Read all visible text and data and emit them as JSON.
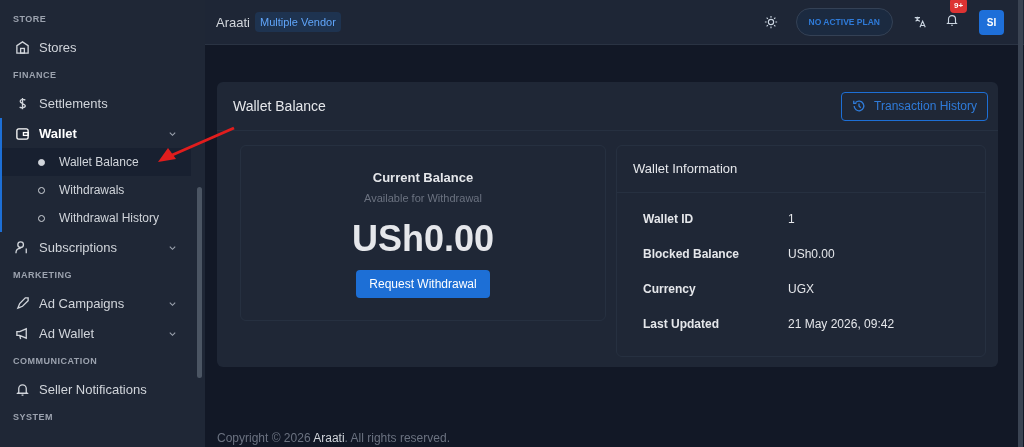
{
  "sidebar": {
    "sections": [
      {
        "title": "STORE",
        "items": [
          {
            "label": "Stores",
            "active": false,
            "has_submenu": false
          }
        ]
      },
      {
        "title": "FINANCE",
        "items": [
          {
            "label": "Settlements",
            "active": false,
            "has_submenu": false
          },
          {
            "label": "Wallet",
            "active": true,
            "has_submenu": true,
            "children": [
              {
                "label": "Wallet Balance",
                "selected": true
              },
              {
                "label": "Withdrawals",
                "selected": false
              },
              {
                "label": "Withdrawal History",
                "selected": false
              }
            ]
          },
          {
            "label": "Subscriptions",
            "active": false,
            "has_submenu": true
          }
        ]
      },
      {
        "title": "MARKETING",
        "items": [
          {
            "label": "Ad Campaigns",
            "active": false,
            "has_submenu": true
          },
          {
            "label": "Ad Wallet",
            "active": false,
            "has_submenu": true
          }
        ]
      },
      {
        "title": "COMMUNICATION",
        "items": [
          {
            "label": "Seller Notifications",
            "active": false,
            "has_submenu": false
          }
        ]
      },
      {
        "title": "SYSTEM"
      }
    ]
  },
  "header": {
    "brand": "Araati",
    "badge": "Multiple Vendor",
    "plan": "NO ACTIVE PLAN",
    "notification_count": "9+",
    "avatar": "SI"
  },
  "card": {
    "title": "Wallet Balance",
    "action": "Transaction History",
    "balance": {
      "title": "Current Balance",
      "subtitle": "Available for Withdrawal",
      "amount": "USh0.00",
      "button": "Request Withdrawal"
    },
    "info": {
      "title": "Wallet Information",
      "rows": [
        {
          "label": "Wallet ID",
          "value": "1"
        },
        {
          "label": "Blocked Balance",
          "value": "USh0.00"
        },
        {
          "label": "Currency",
          "value": "UGX"
        },
        {
          "label": "Last Updated",
          "value": "21 May 2026, 09:42"
        }
      ]
    }
  },
  "footer": "Copyright © 2026 **Araati**. All rights reserved."
}
